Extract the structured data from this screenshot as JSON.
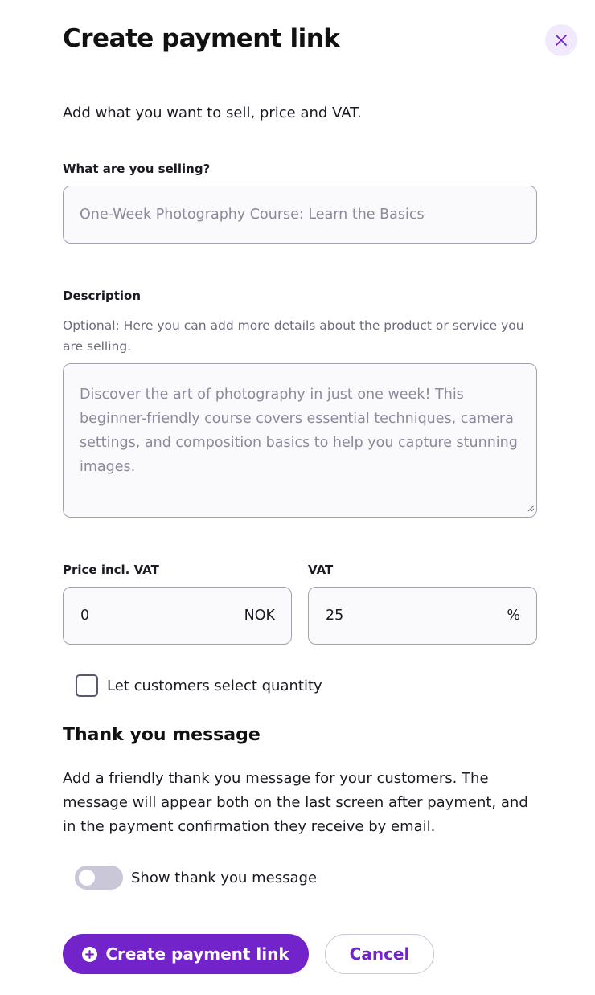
{
  "dialog": {
    "title": "Create payment link",
    "close_icon": "close-icon",
    "intro": "Add what you want to sell, price and VAT."
  },
  "product": {
    "label": "What are you selling?",
    "value": "",
    "placeholder": "One-Week Photography Course: Learn the Basics"
  },
  "description": {
    "label": "Description",
    "helper": "Optional: Here you can add more details about the product or service you are selling.",
    "value": "",
    "placeholder": "Discover the art of photography in just one week! This beginner-friendly course covers essential techniques, camera settings, and composition basics to help you capture stunning images."
  },
  "price": {
    "label": "Price incl. VAT",
    "value": "0",
    "currency": "NOK"
  },
  "vat": {
    "label": "VAT",
    "value": "25",
    "unit": "%"
  },
  "quantity": {
    "label": "Let customers select quantity",
    "checked": false
  },
  "thank_you": {
    "title": "Thank you message",
    "text": "Add a friendly thank you message for your customers. The message will appear both on the last screen after payment, and in the payment confirmation they receive by email.",
    "toggle_label": "Show thank you message",
    "enabled": false
  },
  "actions": {
    "create_label": "Create payment link",
    "create_icon": "plus-circle-icon",
    "cancel_label": "Cancel"
  },
  "colors": {
    "accent": "#7223c9",
    "close_bg": "#f0eafc",
    "toggle_off": "#c9c7d8"
  }
}
